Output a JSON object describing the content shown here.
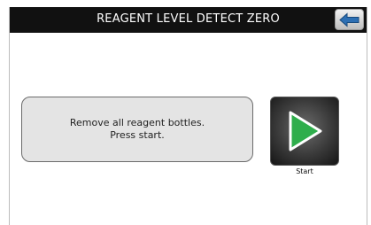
{
  "header": {
    "title": "REAGENT LEVEL DETECT ZERO",
    "back_icon": "back-arrow-icon"
  },
  "message": {
    "line1": "Remove all reagent bottles.",
    "line2": "Press start."
  },
  "start_button": {
    "label": "Start",
    "icon": "play-icon",
    "icon_color": "#2fae4c"
  }
}
